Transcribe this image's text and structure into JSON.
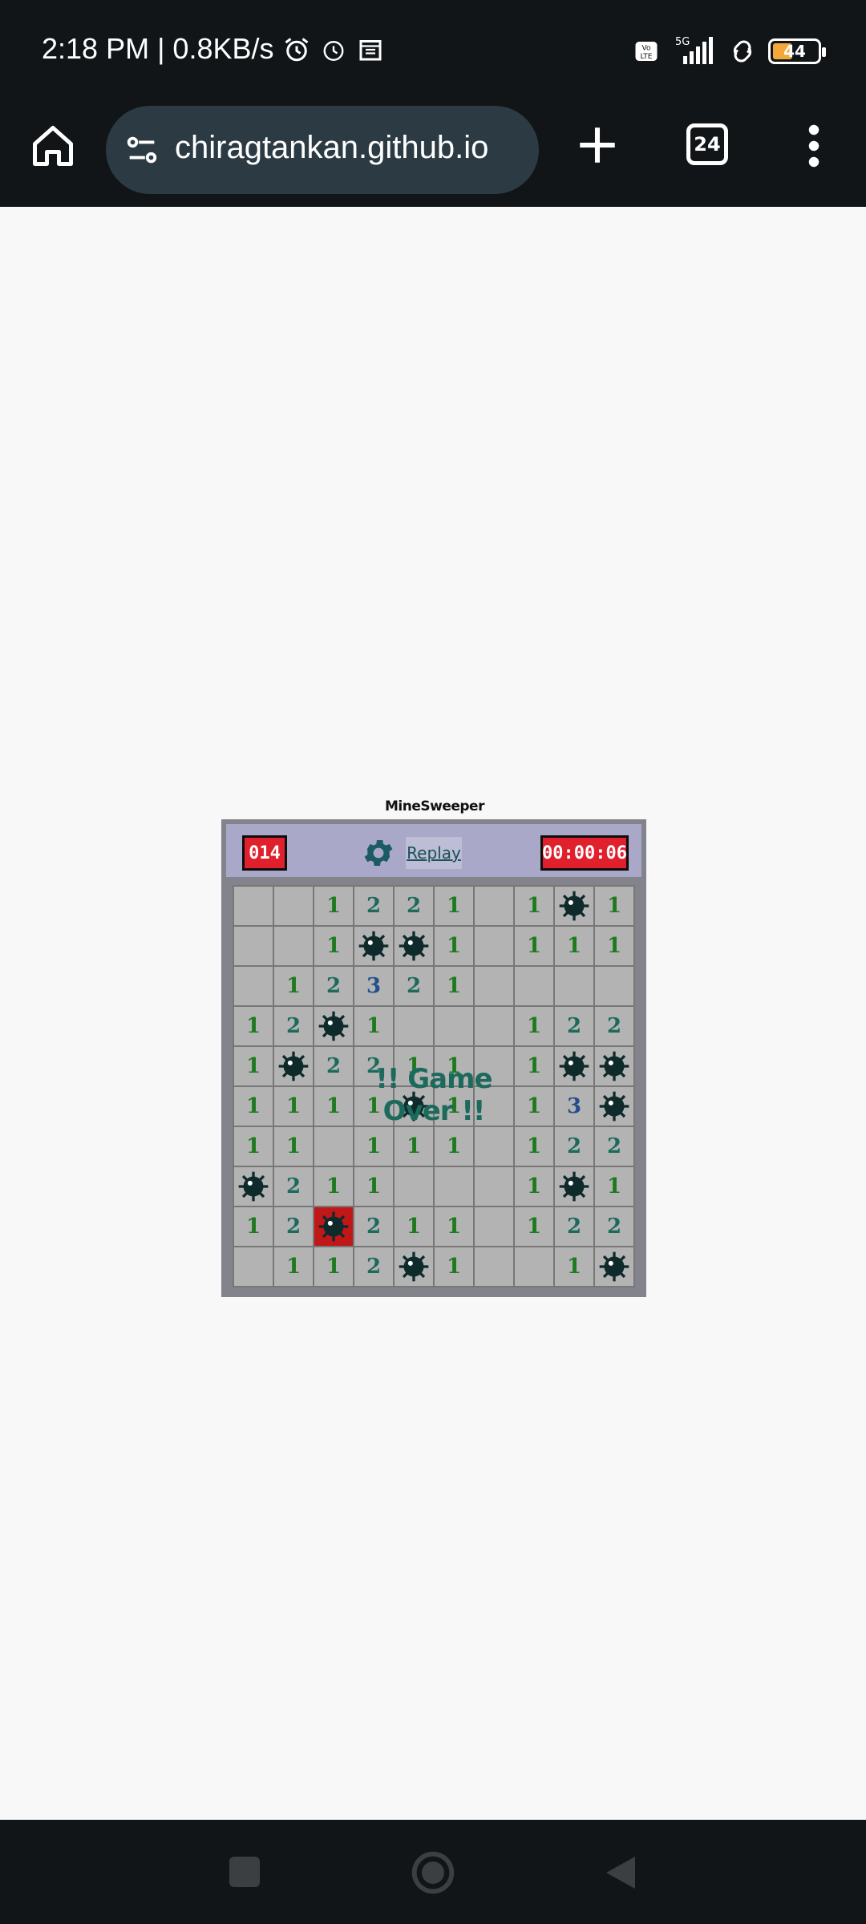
{
  "status_bar": {
    "time": "2:18 PM | 0.8KB/s",
    "network_label": "5G",
    "volte_label": "Vo\nLTE",
    "battery_level": "44"
  },
  "browser": {
    "url": "chiragtankan.github.io",
    "tab_count": "24"
  },
  "game": {
    "title": "MineSweeper",
    "mines_left": "014",
    "timer": "00:00:06",
    "replay_label": "Replay",
    "game_over_text": "!! Game Over !!",
    "board": [
      [
        "",
        "",
        "1",
        "2",
        "2",
        "1",
        "",
        "1",
        "M",
        "1"
      ],
      [
        "",
        "",
        "1",
        "M",
        "M",
        "1",
        "",
        "1",
        "1",
        "1"
      ],
      [
        "",
        "1",
        "2",
        "3",
        "2",
        "1",
        "",
        "",
        "",
        ""
      ],
      [
        "1",
        "2",
        "M",
        "1",
        "",
        "",
        "",
        "1",
        "2",
        "2"
      ],
      [
        "1",
        "M",
        "2",
        "2",
        "1",
        "1",
        "",
        "1",
        "M",
        "M"
      ],
      [
        "1",
        "1",
        "1",
        "1",
        "M",
        "1",
        "",
        "1",
        "3",
        "M"
      ],
      [
        "1",
        "1",
        "",
        "1",
        "1",
        "1",
        "",
        "1",
        "2",
        "2"
      ],
      [
        "M",
        "2",
        "1",
        "1",
        "",
        "",
        "",
        "1",
        "M",
        "1"
      ],
      [
        "1",
        "2",
        "X",
        "2",
        "1",
        "1",
        "",
        "1",
        "2",
        "2"
      ],
      [
        "",
        "1",
        "1",
        "2",
        "M",
        "1",
        "",
        "",
        "1",
        "M"
      ]
    ]
  },
  "icons": {
    "home": "home-icon",
    "site_settings": "tune-icon",
    "new_tab": "plus-icon",
    "menu": "more-vert-icon",
    "settings": "gear-icon"
  },
  "colors": {
    "accent_red": "#e0202c",
    "header_bg": "#a9a8c8",
    "cell_bg": "#b3b3b3",
    "number_green": "#1e7a1e",
    "number_teal": "#1c6a5c",
    "number_blue": "#234f8c"
  }
}
